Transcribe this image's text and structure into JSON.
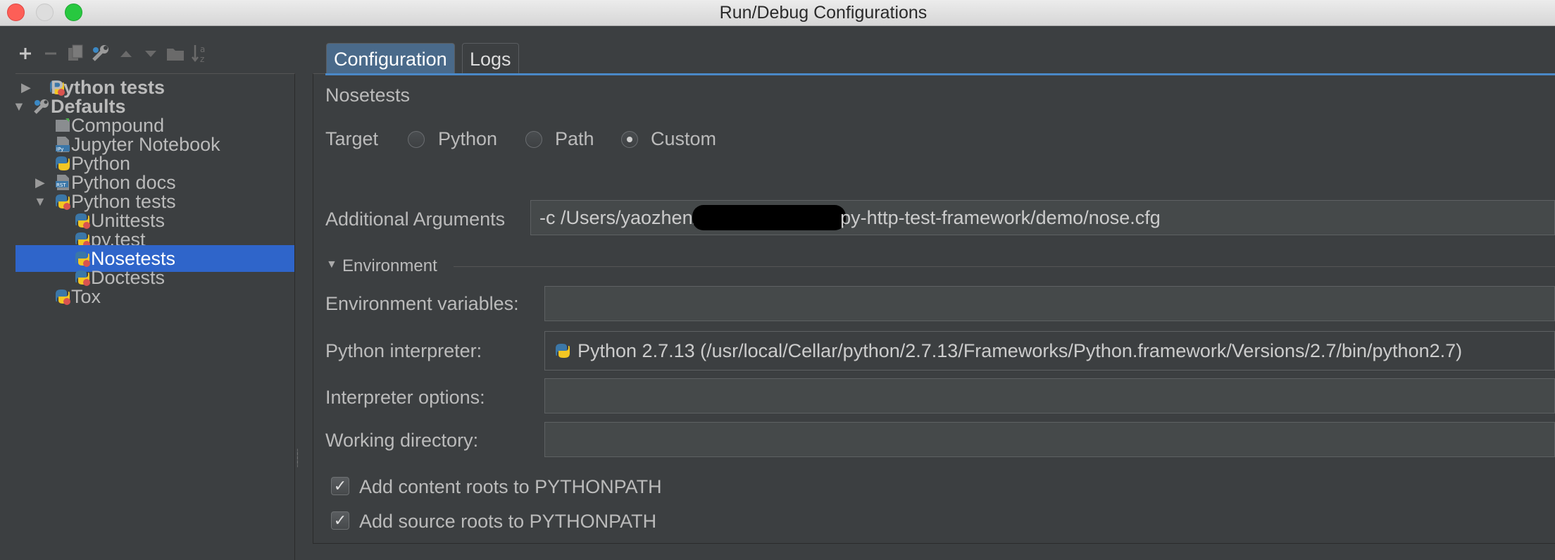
{
  "window": {
    "title": "Run/Debug Configurations"
  },
  "toolbar": {
    "buttons": [
      "add-icon",
      "remove-icon",
      "copy-icon",
      "edit-defaults-icon",
      "move-up-icon",
      "move-down-icon",
      "folder-icon",
      "sort-icon"
    ]
  },
  "tree": {
    "items": [
      {
        "label": "Python tests",
        "level": 0,
        "expanded": false,
        "bold": true,
        "icon": "python-tests-icon"
      },
      {
        "label": "Defaults",
        "level": 0,
        "expanded": true,
        "bold": true,
        "icon": "wrench-icon"
      },
      {
        "label": "Compound",
        "level": 1,
        "icon": "compound-icon"
      },
      {
        "label": "Jupyter Notebook",
        "level": 1,
        "icon": "jupyter-icon"
      },
      {
        "label": "Python",
        "level": 1,
        "icon": "python-icon"
      },
      {
        "label": "Python docs",
        "level": 1,
        "expanded": false,
        "icon": "rst-icon"
      },
      {
        "label": "Python tests",
        "level": 1,
        "expanded": true,
        "icon": "python-tests-icon"
      },
      {
        "label": "Unittests",
        "level": 2,
        "icon": "python-tests-icon"
      },
      {
        "label": "py.test",
        "level": 2,
        "icon": "python-tests-icon"
      },
      {
        "label": "Nosetests",
        "level": 2,
        "icon": "python-tests-icon",
        "selected": true
      },
      {
        "label": "Doctests",
        "level": 2,
        "icon": "python-tests-icon"
      },
      {
        "label": "Tox",
        "level": 1,
        "icon": "python-tests-icon"
      }
    ]
  },
  "tabs": [
    {
      "label": "Configuration",
      "active": true
    },
    {
      "label": "Logs",
      "active": false
    }
  ],
  "config": {
    "name": "Nosetests",
    "target_label": "Target",
    "target_options": [
      "Python",
      "Path",
      "Custom"
    ],
    "target_selected": "Custom",
    "additional_args_label": "Additional Arguments",
    "additional_args_prefix": "-c /Users/yaozhen/",
    "additional_args_suffix": "py-http-test-framework/demo/nose.cfg",
    "environment_section": "Environment",
    "env_vars_label": "Environment variables:",
    "env_vars_value": "",
    "interpreter_label": "Python interpreter:",
    "interpreter_value": "Python 2.7.13 (/usr/local/Cellar/python/2.7.13/Frameworks/Python.framework/Versions/2.7/bin/python2.7)",
    "interp_options_label": "Interpreter options:",
    "interp_options_value": "",
    "working_dir_label": "Working directory:",
    "working_dir_value": "",
    "add_content_roots_label": "Add content roots to PYTHONPATH",
    "add_content_roots_checked": true,
    "add_source_roots_label": "Add source roots to PYTHONPATH",
    "add_source_roots_checked": true
  },
  "colors": {
    "background": "#3c3f41",
    "selection": "#2f65ca",
    "active_tab": "#4a6a8a",
    "text": "#bbbbbb"
  }
}
